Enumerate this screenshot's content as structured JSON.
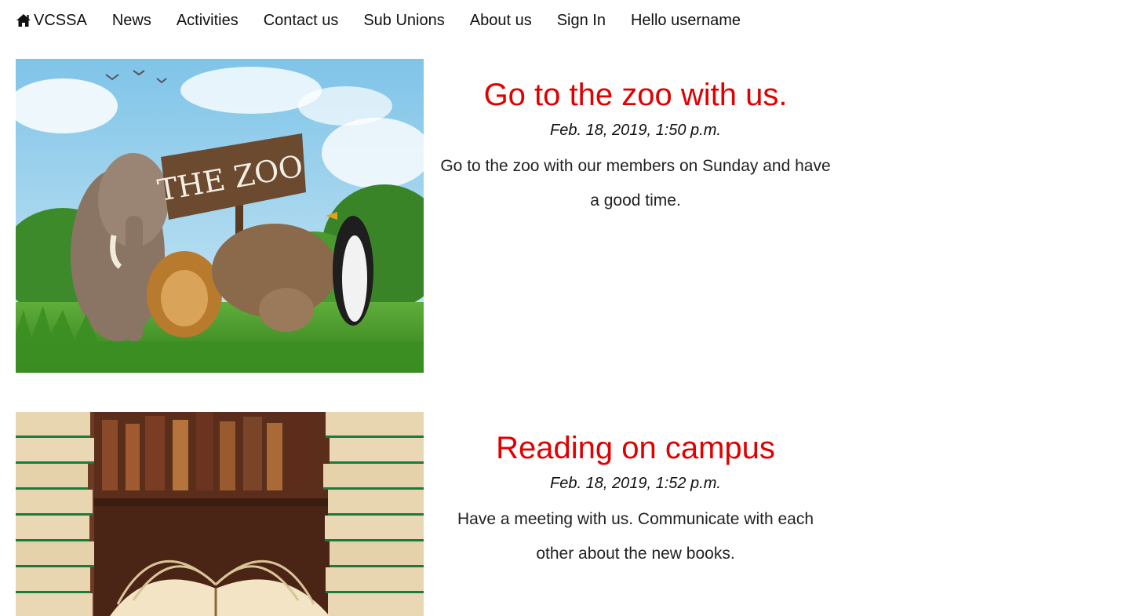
{
  "nav": {
    "brand": "VCSSA",
    "brand_icon": "home-icon",
    "items": [
      "News",
      "Activities",
      "Contact us",
      "Sub Unions",
      "About us",
      "Sign In",
      "Hello username"
    ]
  },
  "posts": [
    {
      "title": "Go to the zoo with us.",
      "date": "Feb. 18, 2019, 1:50 p.m.",
      "body": "Go to the zoo with our members on Sunday and have a good time.",
      "image_sign_text": "THE ZOO"
    },
    {
      "title": "Reading on campus",
      "date": "Feb. 18, 2019, 1:52 p.m.",
      "body": "Have a meeting with us. Communicate with each other about the new books."
    }
  ],
  "colors": {
    "title": "#e00000",
    "text": "#222222"
  }
}
